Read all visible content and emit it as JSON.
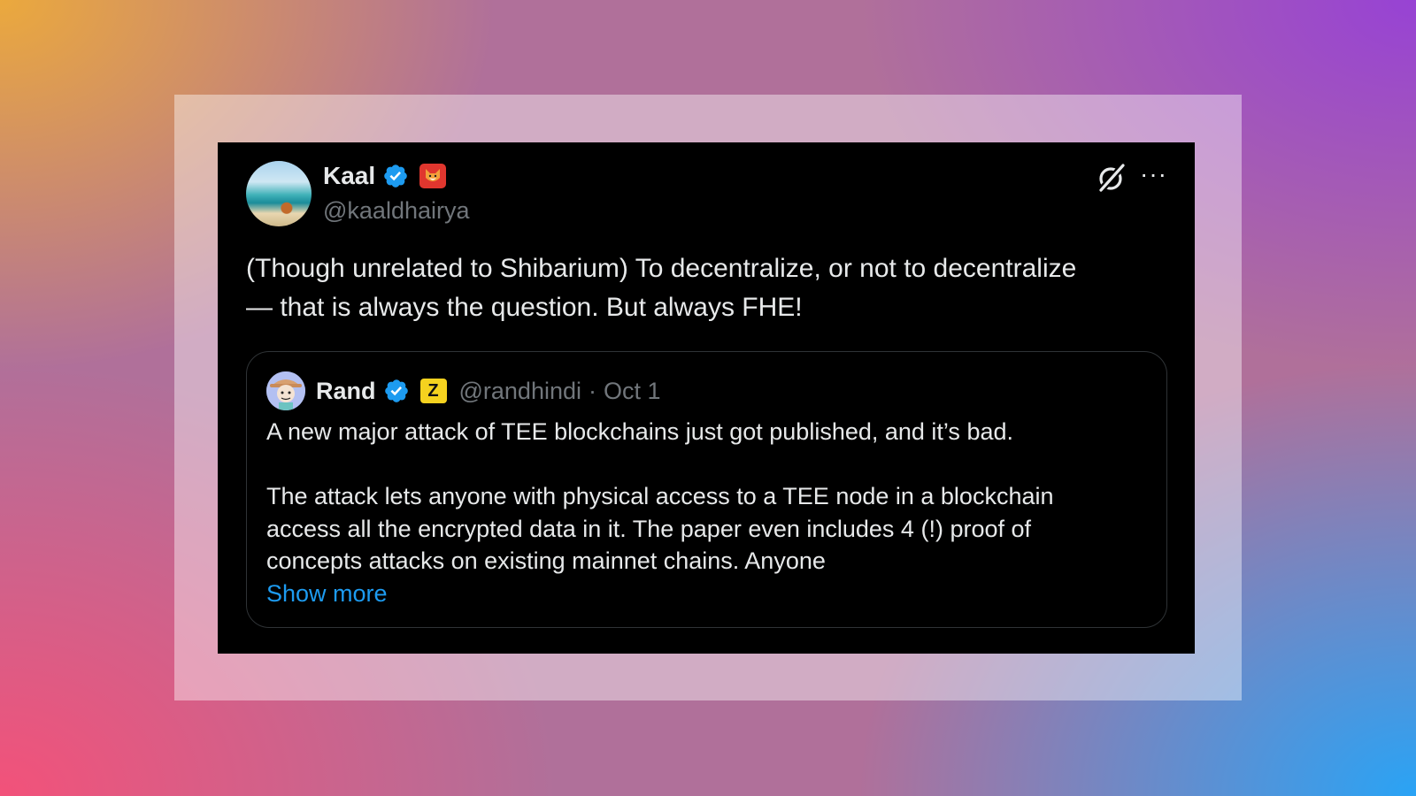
{
  "background": {
    "gradient_colors": [
      "#eeac38",
      "#9640d7",
      "#f65078",
      "#22a6fa"
    ]
  },
  "tweet": {
    "author": {
      "name": "Kaal",
      "handle": "@kaaldhairya",
      "verified": true,
      "badge_icon": "shiba-emoji-icon"
    },
    "actions": {
      "grok_icon": "grok-icon",
      "more_label": "···"
    },
    "text_lines": [
      "(Though unrelated to Shibarium) To decentralize, or not to decentralize",
      "— that is always the question. But always FHE!"
    ],
    "quoted": {
      "author": {
        "name": "Rand",
        "handle": "@randhindi",
        "verified": true,
        "badge_text": "Z"
      },
      "separator": "·",
      "date": "Oct 1",
      "paragraph1": "A new major attack of TEE blockchains just got published, and it’s bad.",
      "paragraph2_lines": [
        "The attack lets anyone with physical access to a TEE node in a blockchain",
        "access all the encrypted data in it. The paper even includes 4 (!) proof of",
        "concepts attacks on existing mainnet chains. Anyone"
      ],
      "show_more": "Show more"
    }
  },
  "colors": {
    "card_bg": "#000000",
    "text": "#e7e9ea",
    "muted": "#71767b",
    "link": "#1d9bf0",
    "verified": "#1d9bf0",
    "border": "#2f3336"
  }
}
